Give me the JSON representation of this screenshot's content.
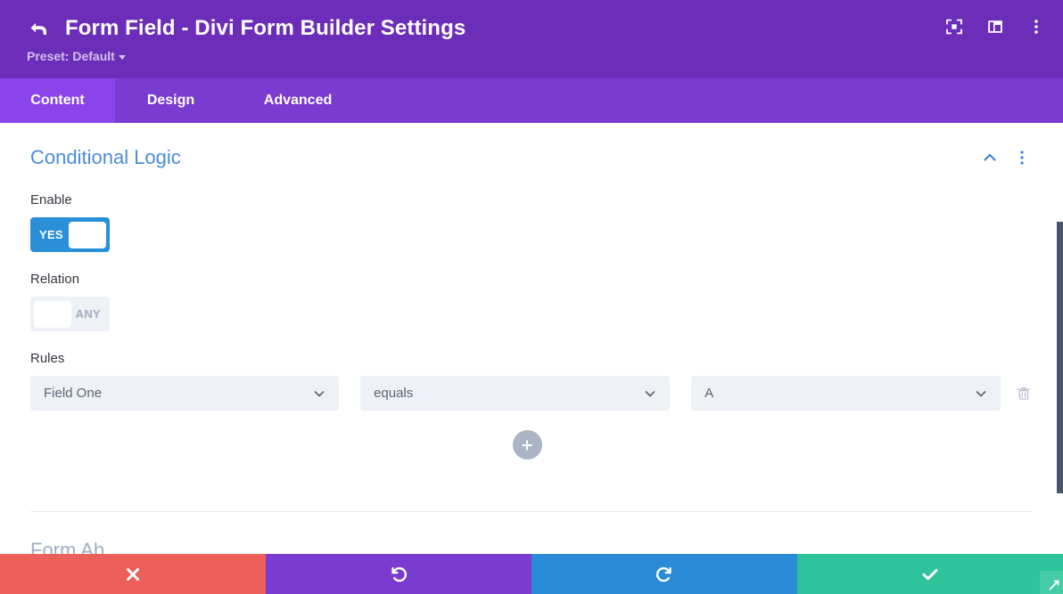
{
  "header": {
    "title": "Form Field - Divi Form Builder Settings",
    "back_icon": "back-arrow-icon",
    "preset_label": "Preset: Default",
    "icons": [
      {
        "name": "fullscreen-icon",
        "label": "Fullscreen"
      },
      {
        "name": "layout-panel-icon",
        "label": "Layout"
      },
      {
        "name": "more-options-icon",
        "label": "More"
      }
    ]
  },
  "tabs": [
    {
      "label": "Content",
      "active": true
    },
    {
      "label": "Design",
      "active": false
    },
    {
      "label": "Advanced",
      "active": false
    }
  ],
  "section": {
    "title": "Conditional Logic",
    "collapse_icon": "chevron-up-icon",
    "menu_icon": "more-options-icon"
  },
  "fields": {
    "enable": {
      "label": "Enable",
      "state": "on",
      "value_text": "YES"
    },
    "relation": {
      "label": "Relation",
      "state": "off",
      "value_text": "ANY"
    },
    "rules": {
      "label": "Rules",
      "rows": [
        {
          "field": "Field One",
          "operator": "equals",
          "value": "A",
          "delete_icon": "trash-icon"
        }
      ],
      "add_icon": "plus-icon"
    }
  },
  "next_section": {
    "title": "Form Ab"
  },
  "action_bar": [
    {
      "name": "cancel-button",
      "icon": "close-x-icon",
      "color": "#ec5f5b"
    },
    {
      "name": "undo-button",
      "icon": "undo-arrow-icon",
      "color": "#7a3bd0"
    },
    {
      "name": "redo-button",
      "icon": "redo-arrow-icon",
      "color": "#2a8bd6"
    },
    {
      "name": "save-button",
      "icon": "checkmark-icon",
      "color": "#2dc49b"
    }
  ],
  "colors": {
    "header_purple": "#6c2eb9",
    "tab_purple": "#7a3bd0",
    "tab_active_purple": "#8b44ea",
    "section_title_blue": "#4a8bde",
    "toggle_on_blue": "#2990d8",
    "input_bg": "#eef1f6"
  }
}
